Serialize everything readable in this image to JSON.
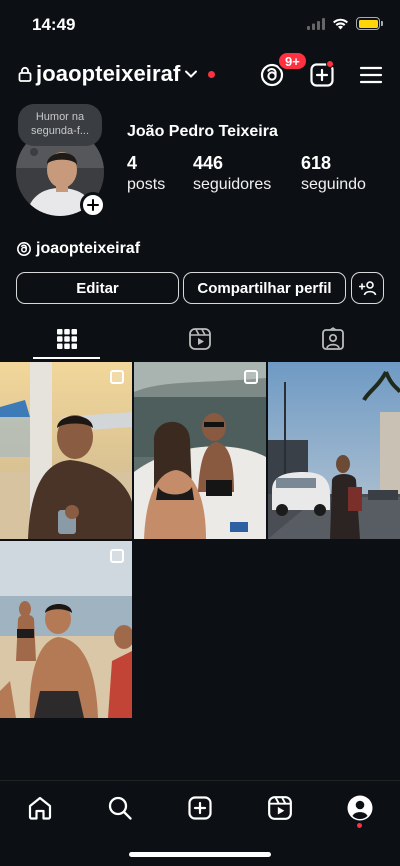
{
  "status_bar": {
    "time": "14:49"
  },
  "header": {
    "username": "joaopteixeiraf",
    "notification_badge": "9+"
  },
  "profile": {
    "note": "Humor na segunda-f...",
    "full_name": "João Pedro Teixeira",
    "stats": [
      {
        "value": "4",
        "label": "posts"
      },
      {
        "value": "446",
        "label": "seguidores"
      },
      {
        "value": "618",
        "label": "seguindo"
      }
    ],
    "threads_handle": "joaopteixeiraf"
  },
  "actions": {
    "edit_label": "Editar",
    "share_label": "Compartilhar perfil"
  },
  "tabs": [
    {
      "name": "grid-icon",
      "active": true
    },
    {
      "name": "reels-icon",
      "active": false
    },
    {
      "name": "tagged-icon",
      "active": false
    }
  ],
  "posts": [
    {
      "name": "post-beach-portrait",
      "multi": true
    },
    {
      "name": "post-boat-couple",
      "multi": true
    },
    {
      "name": "post-street-scene",
      "multi": false
    },
    {
      "name": "post-beach-group",
      "multi": true
    }
  ],
  "nav": [
    "home-icon",
    "search-icon",
    "create-icon",
    "reels-icon",
    "profile-icon"
  ],
  "colors": {
    "background": "#0c1014",
    "accent_red": "#ff3040",
    "battery": "#ffd60a"
  }
}
